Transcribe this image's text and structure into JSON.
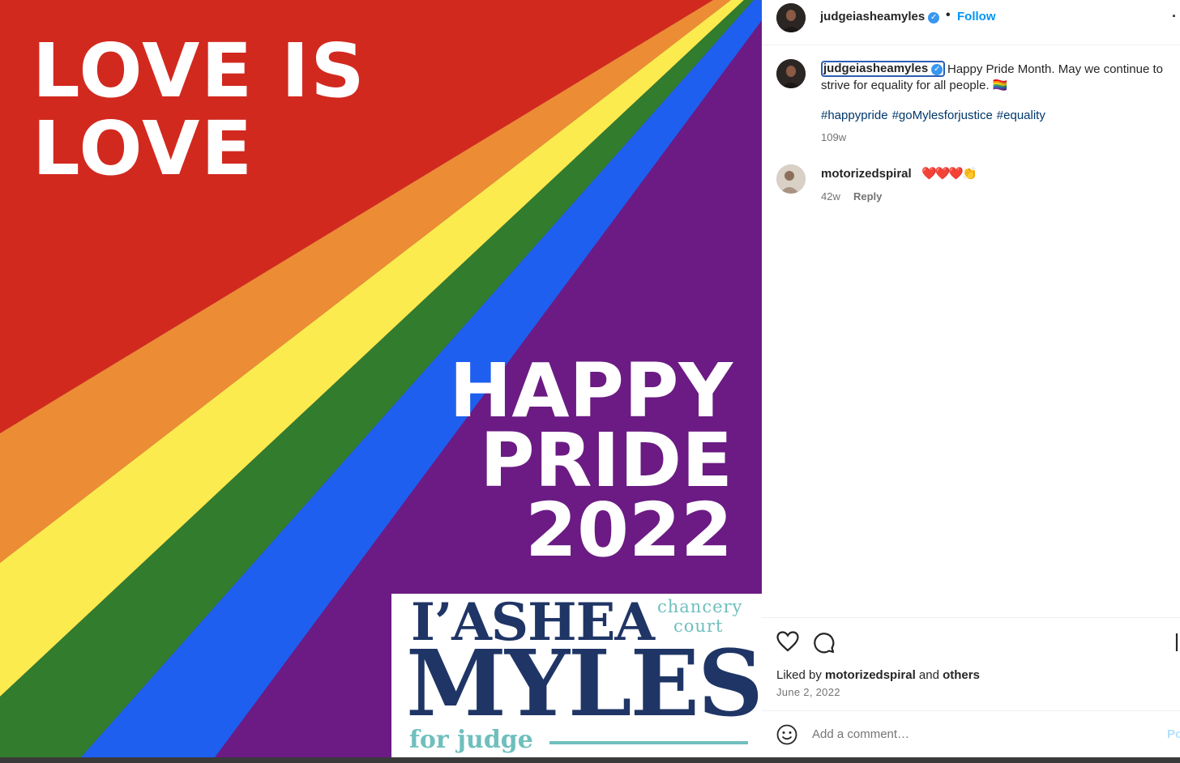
{
  "post_image": {
    "headline_top": [
      "LOVE IS",
      "LOVE"
    ],
    "headline_bottom": [
      "HAPPY",
      "PRIDE",
      "2022"
    ],
    "logo": {
      "first_name": "I’ASHEA",
      "office_line1": "chancery",
      "office_line2": "court",
      "last_name": "MYLES",
      "tagline": "for judge"
    },
    "colors": {
      "red": "#d2291f",
      "orange": "#ec8c34",
      "yellow": "#fceb4e",
      "green": "#327c2e",
      "blue": "#1e5ff0",
      "purple": "#6b1b83",
      "navy": "#1f3566",
      "teal": "#6fbfbd"
    }
  },
  "header": {
    "username": "judgeiasheamyles",
    "verified_icon": "verified-badge-icon",
    "separator": "•",
    "follow_label": "Follow",
    "more_icon": "ellipsis-icon"
  },
  "caption": {
    "username": "judgeiasheamyles",
    "text": "Happy Pride Month. May we continue to strive for equality for all people. 🏳️‍🌈",
    "hashtags": [
      "#happypride",
      "#goMylesforjustice",
      "#equality"
    ],
    "time": "109w"
  },
  "comments": [
    {
      "username": "motorizedspiral",
      "text": "❤️❤️❤️👏",
      "time": "42w",
      "reply_label": "Reply"
    }
  ],
  "actions": {
    "like_icon": "heart-icon",
    "comment_icon": "comment-bubble-icon",
    "save_icon": "bookmark-icon"
  },
  "likes": {
    "prefix": "Liked by",
    "user": "motorizedspiral",
    "joiner": "and",
    "others": "others"
  },
  "post_date": "June 2, 2022",
  "add_comment": {
    "emoji_icon": "smiley-icon",
    "placeholder": "Add a comment…",
    "post_label": "Post"
  }
}
